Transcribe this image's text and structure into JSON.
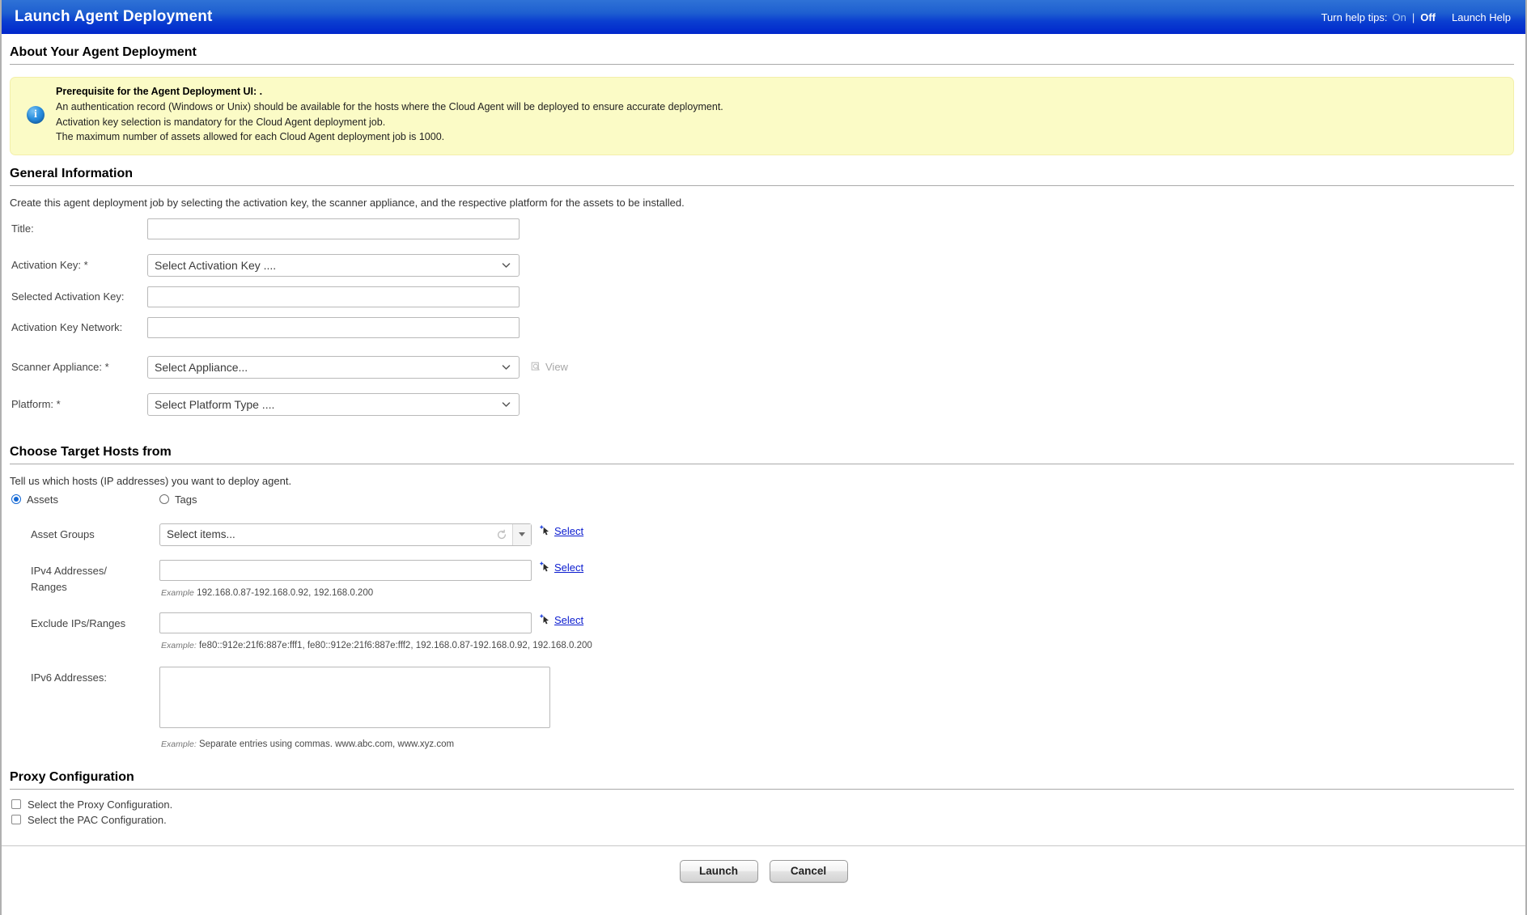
{
  "titlebar": {
    "title": "Launch Agent Deployment",
    "help_tips_label": "Turn help tips:",
    "help_on": "On",
    "help_sep": "|",
    "help_off": "Off",
    "launch_help": "Launch Help",
    "accent_color": "#0026cc"
  },
  "about": {
    "heading": "About Your Agent Deployment",
    "notice": {
      "title": "Prerequisite for the Agent Deployment UI: .",
      "lines": [
        "An authentication record (Windows or Unix) should be available for the hosts where the Cloud Agent will be deployed to ensure accurate deployment.",
        "Activation key selection is mandatory for the Cloud Agent deployment job.",
        "The maximum number of assets allowed for each Cloud Agent deployment job is 1000."
      ],
      "background_color": "#fbfbc6",
      "icon": "info-icon"
    }
  },
  "general": {
    "heading": "General Information",
    "intro": "Create this agent deployment job by selecting the activation key, the scanner appliance, and the respective platform for the assets to be installed.",
    "fields": {
      "title": {
        "label": "Title:",
        "value": "",
        "placeholder": ""
      },
      "activation_key": {
        "label": "Activation Key: *",
        "value": "Select Activation Key ...."
      },
      "selected_activation_key": {
        "label": "Selected Activation Key:",
        "value": "",
        "placeholder": ""
      },
      "activation_key_network": {
        "label": "Activation Key Network:",
        "value": "",
        "placeholder": ""
      },
      "scanner_appliance": {
        "label": "Scanner Appliance: *",
        "value": "Select Appliance...",
        "view_label": "View"
      },
      "platform": {
        "label": "Platform: *",
        "value": "Select Platform Type ...."
      }
    }
  },
  "target_hosts": {
    "heading": "Choose Target Hosts from",
    "intro": "Tell us which hosts (IP addresses) you want to deploy agent.",
    "radios": [
      {
        "label": "Assets",
        "checked": true
      },
      {
        "label": "Tags",
        "checked": false
      }
    ],
    "asset_groups": {
      "label": "Asset Groups",
      "value": "Select items...",
      "select_link": "Select"
    },
    "ipv4": {
      "label": "IPv4 Addresses/ Ranges",
      "label_line1": "IPv4 Addresses/",
      "label_line2": "Ranges",
      "value": "",
      "select_link": "Select",
      "example_prefix": "Example",
      "example_text": "192.168.0.87-192.168.0.92, 192.168.0.200"
    },
    "exclude_ips": {
      "label": "Exclude IPs/Ranges",
      "value": "",
      "select_link": "Select",
      "example_prefix": "Example:",
      "example_text": "fe80::912e:21f6:887e:fff1, fe80::912e:21f6:887e:fff2, 192.168.0.87-192.168.0.92, 192.168.0.200"
    },
    "ipv6": {
      "label": "IPv6 Addresses:",
      "value": "",
      "example_prefix": "Example:",
      "example_text": "Separate entries using commas. www.abc.com, www.xyz.com"
    }
  },
  "proxy": {
    "heading": "Proxy Configuration",
    "checkboxes": [
      {
        "label": "Select the Proxy Configuration.",
        "checked": false
      },
      {
        "label": "Select the PAC Configuration.",
        "checked": false
      }
    ]
  },
  "footer": {
    "launch": "Launch",
    "cancel": "Cancel"
  }
}
